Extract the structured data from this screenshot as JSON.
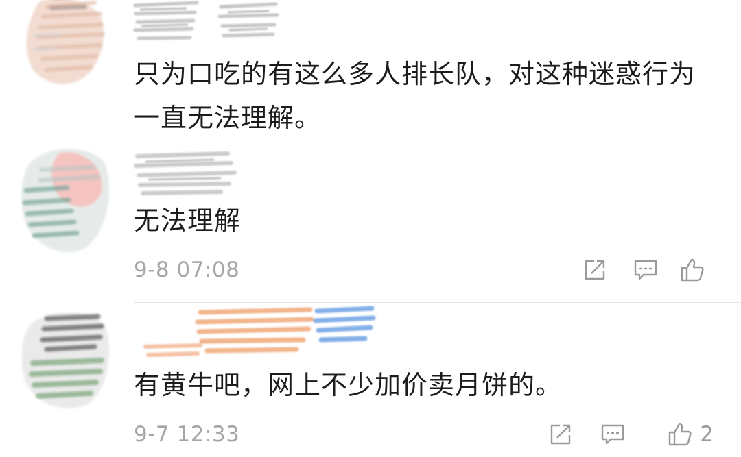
{
  "comments": [
    {
      "text": "只为口吃的有这么多人排长队，对这种迷惑行为一直无法理解。"
    },
    {
      "text": "无法理解",
      "time": "9-8 07:08",
      "likes": ""
    },
    {
      "text": "有黄牛吧，网上不少加价卖月饼的。",
      "time": "9-7 12:33",
      "likes": "2"
    }
  ],
  "icons": {
    "share": "share-icon",
    "reply": "comment-icon",
    "like": "thumbs-up-icon"
  },
  "colors": {
    "text": "#1c1c1c",
    "meta": "#a6a6a6",
    "icon": "#9a9a9a",
    "divider": "#e6e6e6"
  }
}
